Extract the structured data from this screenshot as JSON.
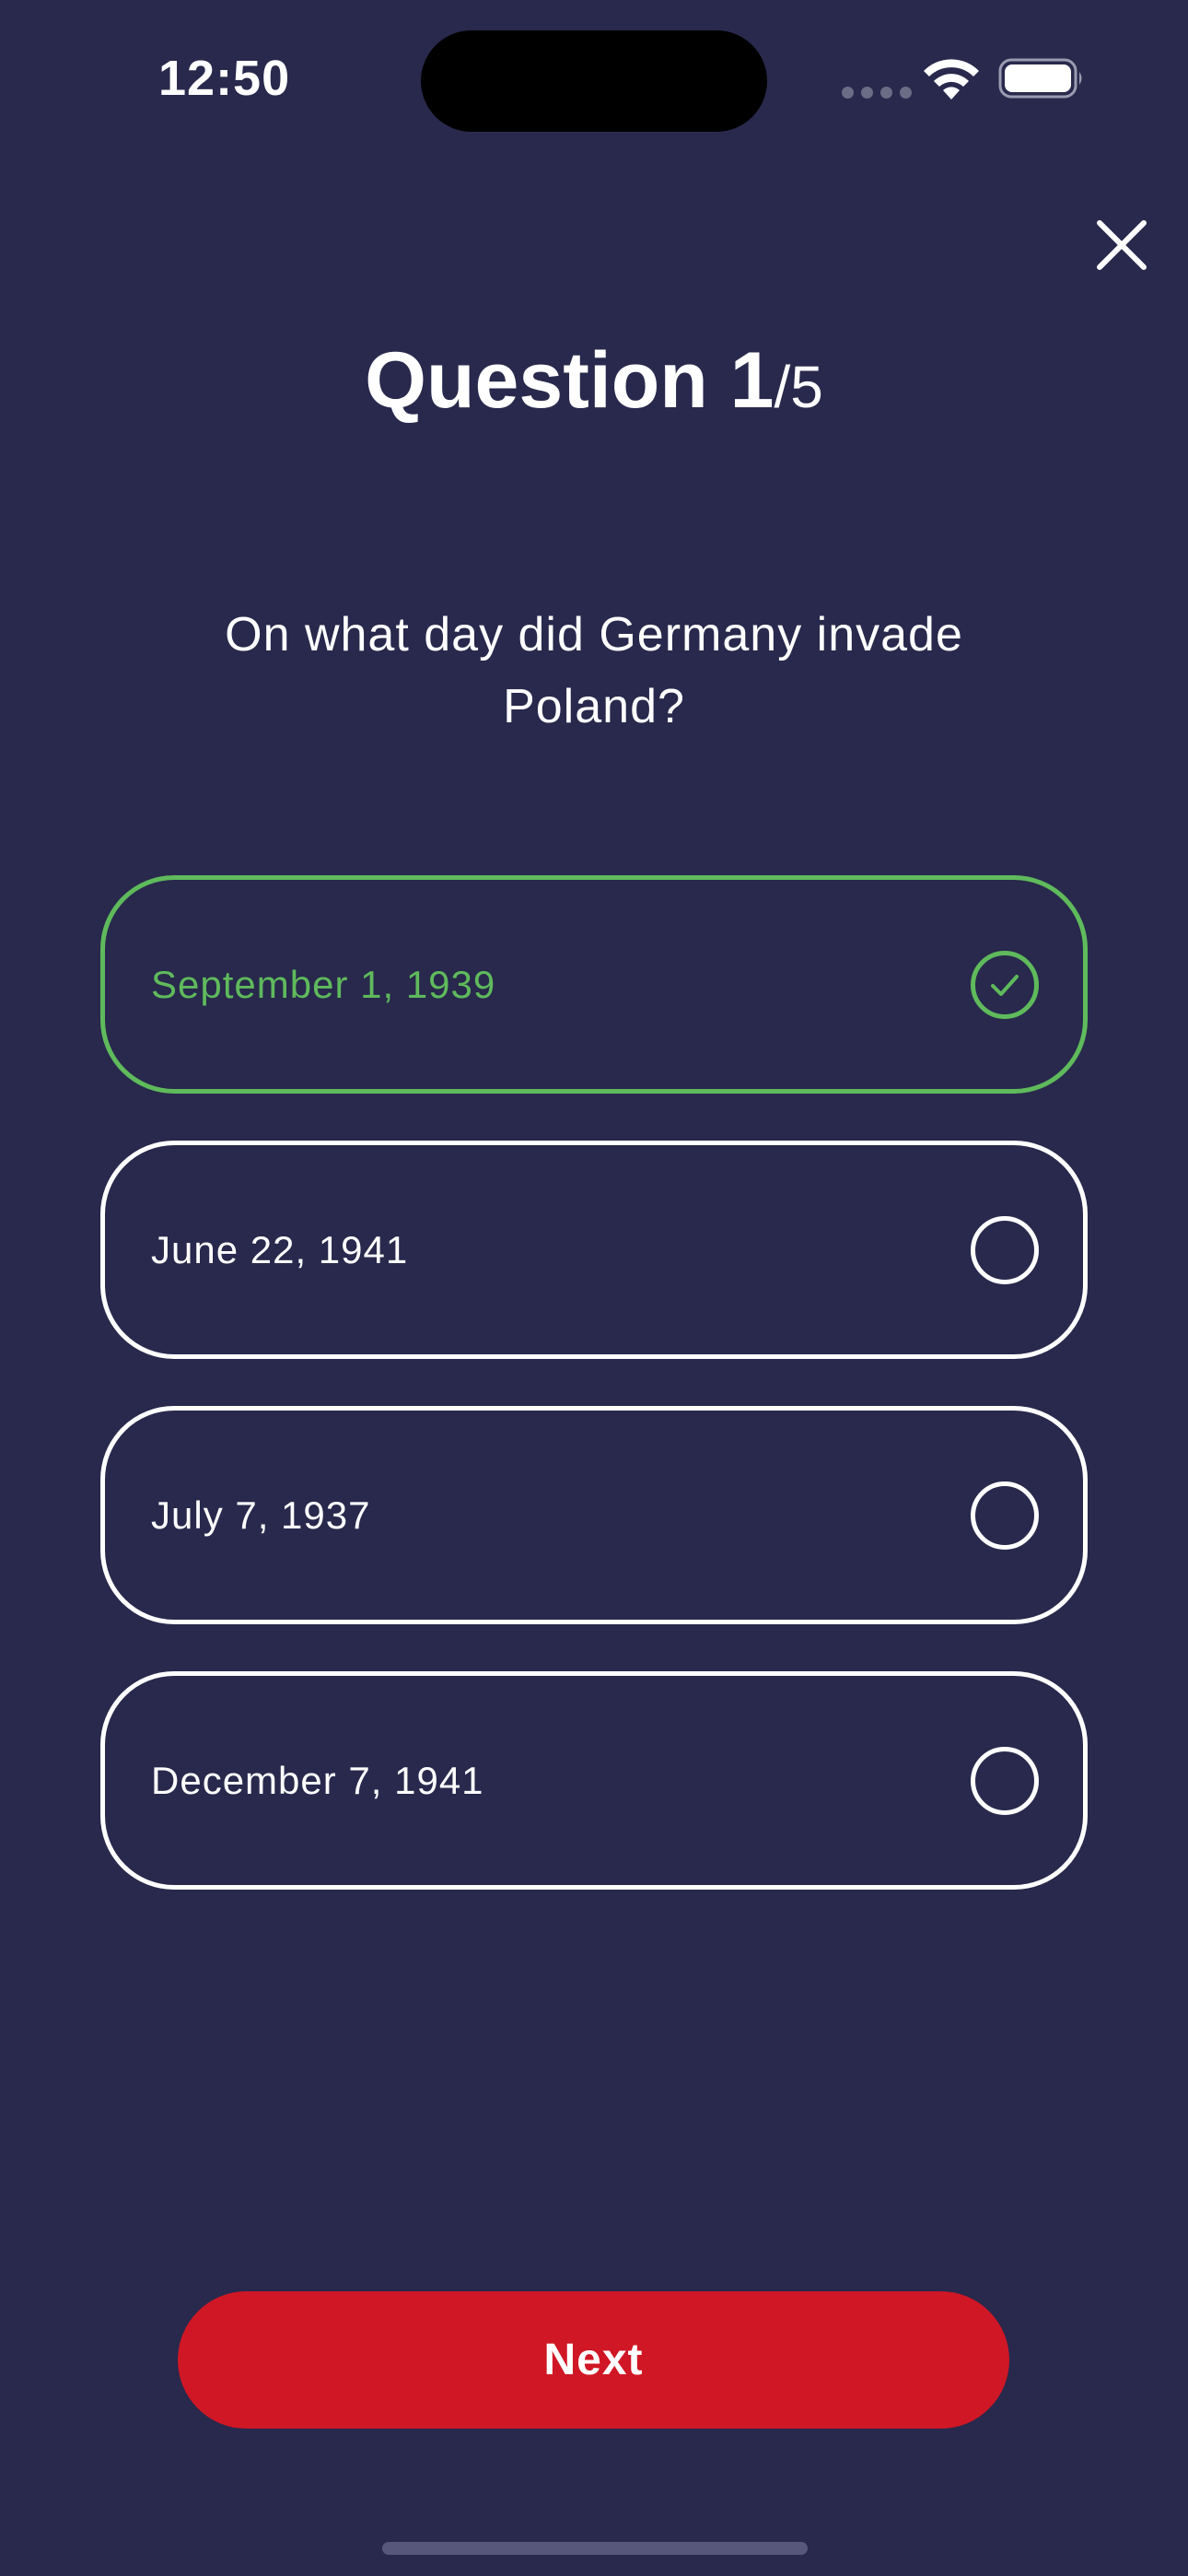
{
  "status_bar": {
    "time": "12:50",
    "wifi_icon": "wifi-icon",
    "battery_icon": "battery-icon"
  },
  "header": {
    "close_icon": "close-icon",
    "title_prefix": "Question 1",
    "title_total": "/5"
  },
  "question": {
    "text": "On what day did Germany invade Poland?"
  },
  "options": [
    {
      "label": "September 1, 1939",
      "selected": true
    },
    {
      "label": "June 22, 1941",
      "selected": false
    },
    {
      "label": "July 7, 1937",
      "selected": false
    },
    {
      "label": "December 7, 1941",
      "selected": false
    }
  ],
  "footer": {
    "next_label": "Next"
  },
  "colors": {
    "background": "#28294c",
    "selected_accent": "#5fba5c",
    "primary_button": "#d01725",
    "text": "#ffffff"
  }
}
